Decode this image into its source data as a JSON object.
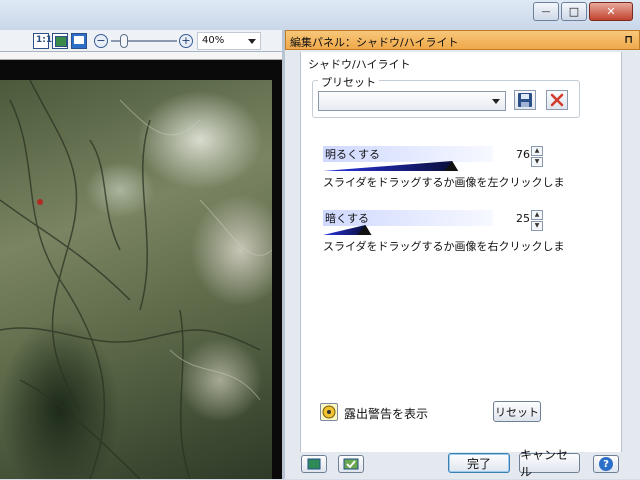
{
  "toolbar": {
    "zoom_level": "40%",
    "zoom_out_symbol": "−",
    "zoom_in_symbol": "+",
    "icons": [
      "actual-size-icon",
      "fit-window-icon",
      "full-screen-icon"
    ]
  },
  "window": {
    "minimize_symbol": "—",
    "maximize_symbol": "□",
    "close_symbol": "✕"
  },
  "panel": {
    "header_title": "編集パネル：シャドウ/ハイライト",
    "pin_symbol": "⊓",
    "section_title": "シャドウ/ハイライト",
    "preset": {
      "label": "プリセット",
      "selected": ""
    },
    "brighten": {
      "label": "明るくする",
      "value": 76,
      "max": 100,
      "hint": "スライダをドラッグするか画像を左クリックしま"
    },
    "darken": {
      "label": "暗くする",
      "value": 25,
      "max": 100,
      "hint": "スライダをドラッグするか画像を右クリックしま"
    },
    "exposure_warning_label": "露出警告を表示",
    "reset_label": "リセット",
    "done_label": "完了",
    "cancel_label": "キャンセル",
    "help_symbol": "?"
  },
  "colors": {
    "panel_header": "#f0a94a",
    "slider_start": "#2a36e8",
    "slider_end": "#0b0f3a",
    "delete_red": "#d23a2a",
    "save_blue": "#2c4f86"
  }
}
